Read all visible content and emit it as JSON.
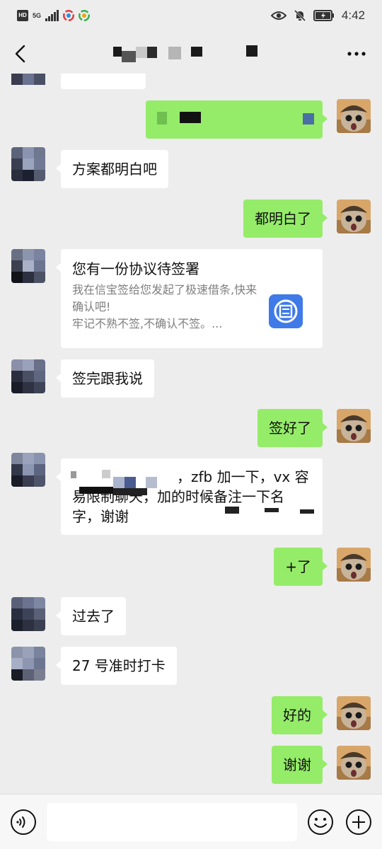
{
  "status_bar": {
    "hd_label": "HD",
    "network_label": "5G",
    "battery_label": "",
    "time": "4:42"
  },
  "header": {
    "title": "",
    "back_icon": "back-chevron-icon",
    "more_icon": "more-dots-icon"
  },
  "messages": [
    {
      "side": "right",
      "type": "text",
      "text": "",
      "redacted": true
    },
    {
      "side": "left",
      "type": "text",
      "text": "方案都明白吧"
    },
    {
      "side": "right",
      "type": "text",
      "text": "都明白了"
    },
    {
      "side": "left",
      "type": "card",
      "title": "您有一份协议待签署",
      "desc": "我在信宝签给您发起了极速借条,快来确认吧!\n牢记不熟不签,不确认不签。...",
      "icon": "app-logo-icon"
    },
    {
      "side": "left",
      "type": "text",
      "text": "签完跟我说"
    },
    {
      "side": "right",
      "type": "text",
      "text": "签好了"
    },
    {
      "side": "left",
      "type": "text",
      "line1": "，zfb 加一下，vx 容",
      "line2": "易限制聊天，加的时候备注一下名",
      "line3": "字，谢谢",
      "redacted": true
    },
    {
      "side": "right",
      "type": "text",
      "text": "+了"
    },
    {
      "side": "left",
      "type": "text",
      "text": "过去了"
    },
    {
      "side": "left",
      "type": "text",
      "text": "27 号准时打卡"
    },
    {
      "side": "right",
      "type": "text",
      "text": "好的"
    },
    {
      "side": "right",
      "type": "text",
      "text": "谢谢"
    }
  ],
  "input_bar": {
    "voice_icon": "voice-icon",
    "input_value": "",
    "emoji_icon": "emoji-icon",
    "plus_icon": "plus-icon"
  },
  "colors": {
    "background": "#ededed",
    "bubble_sent": "#95ec69",
    "bubble_received": "#ffffff",
    "card_icon": "#3f7ae8"
  }
}
